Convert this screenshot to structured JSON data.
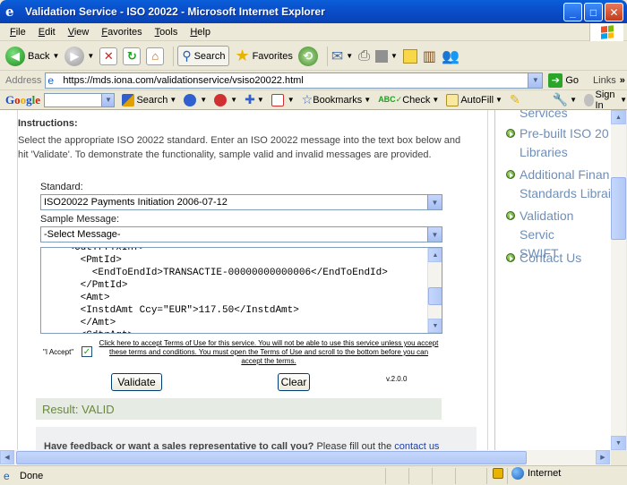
{
  "window": {
    "title": "Validation Service - ISO 20022 - Microsoft Internet Explorer",
    "buttons": {
      "minimize": "_",
      "maximize": "□",
      "close": "✕"
    }
  },
  "menu": [
    {
      "key": "F",
      "rest": "ile"
    },
    {
      "key": "E",
      "rest": "dit"
    },
    {
      "key": "V",
      "rest": "iew"
    },
    {
      "key": "F",
      "rest": "avorites",
      "prefix": ""
    },
    {
      "key": "T",
      "rest": "ools"
    },
    {
      "key": "H",
      "rest": "elp"
    }
  ],
  "toolbar": {
    "back": "Back",
    "search": "Search",
    "favorites": "Favorites"
  },
  "address": {
    "label": "Address",
    "url": "https://mds.iona.com/validationservice/vsiso20022.html",
    "go": "Go",
    "links": "Links"
  },
  "google": {
    "search": "Search",
    "bookmarks": "Bookmarks",
    "check": "Check",
    "autofill": "AutoFill",
    "signin": "Sign In"
  },
  "page": {
    "instructions_title": "Instructions:",
    "instructions_text": "Select the appropriate ISO 20022 standard. Enter an ISO 20022 message into the text box below and hit 'Validate'. To demonstrate the functionality, sample valid and invalid messages are provided.",
    "standard_label": "Standard:",
    "standard_value": "ISO20022 Payments Initiation 2006-07-12",
    "sample_label": "Sample Message:",
    "sample_value": "-Select Message-",
    "message_text": "    <CdtTrfTxInf>\n      <PmtId>\n        <EndToEndId>TRANSACTIE-00000000000006</EndToEndId>\n      </PmtId>\n      <Amt>\n      <InstdAmt Ccy=\"EUR\">117.50</InstdAmt>\n      </Amt>\n      <CdtrAgt>",
    "accept_label": "\"I Accept\"",
    "accept_checked": "✓",
    "terms_text": "Click here to accept Terms of Use for this service. You will not be able to use this service unless you accept these terms and conditions. You must open the Terms of Use and scroll to the bottom before you can accept the terms.",
    "version": "v.2.0.0",
    "validate_button": "Validate",
    "clear_button": "Clear",
    "result": "Result: VALID",
    "feedback_bold": "Have feedback or want a sales representative to call you?",
    "feedback_text": " Please fill out the ",
    "feedback_link": "contact us"
  },
  "sidebar": {
    "items": [
      {
        "label": "Services"
      },
      {
        "label": "Pre-built ISO 20",
        "line2": "Libraries"
      },
      {
        "label": "Additional Finan",
        "line2": "Standards Librai"
      },
      {
        "label": "Validation Servic",
        "line2": "SWIFT"
      },
      {
        "label": "Contact Us"
      }
    ]
  },
  "status": {
    "text": "Done",
    "zone": "Internet"
  },
  "colors": {
    "link": "#6f8fb8",
    "result_text": "#6a8a3a",
    "titlebar": "#0a4fcc"
  }
}
